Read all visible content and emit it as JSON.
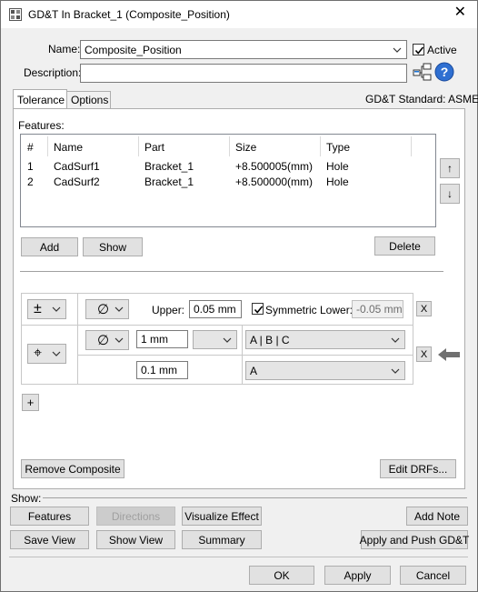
{
  "window": {
    "title": "GD&T In Bracket_1 (Composite_Position)",
    "close_glyph": "✕"
  },
  "header": {
    "name_label": "Name:",
    "name_value": "Composite_Position",
    "active_label": "Active",
    "active_checked": true,
    "description_label": "Description:",
    "description_value": ""
  },
  "tabs": [
    {
      "label": "Tolerance",
      "selected": true
    },
    {
      "label": "Options",
      "selected": false
    }
  ],
  "gdt_standard": "GD&T Standard: ASME",
  "features": {
    "label": "Features:",
    "columns": [
      "#",
      "Name",
      "Part",
      "Size",
      "Type"
    ],
    "rows": [
      [
        "1",
        "CadSurf1",
        "Bracket_1",
        "+8.500005(mm)",
        "Hole"
      ],
      [
        "2",
        "CadSurf2",
        "Bracket_1",
        "+8.500000(mm)",
        "Hole"
      ]
    ],
    "up_label": "↑",
    "down_label": "↓",
    "add_label": "Add",
    "show_label": "Show",
    "delete_label": "Delete"
  },
  "tolerance": {
    "profile_symbol": "±",
    "diameter_symbol": "∅",
    "position_symbol": "⌖",
    "upper_label": "Upper:",
    "upper_value": "0.05 mm",
    "symmetric_label": "Symmetric Lower:",
    "symmetric_checked": true,
    "lower_value": "-0.05 mm",
    "row1_value": "1 mm",
    "row1_modifier": "",
    "row1_datums": "A | B | C",
    "row2_value": "0.1 mm",
    "row2_datums": "A",
    "x_label": "X",
    "plus_label": "+"
  },
  "bottom": {
    "remove_composite_label": "Remove Composite",
    "edit_drfs_label": "Edit DRFs...",
    "show_label": "Show:",
    "features_label": "Features",
    "directions_label": "Directions",
    "visualize_label": "Visualize Effect",
    "add_note_label": "Add Note",
    "save_view_label": "Save View",
    "show_view_label": "Show View",
    "summary_label": "Summary",
    "apply_push_label": "Apply and Push GD&T",
    "ok_label": "OK",
    "apply_label": "Apply",
    "cancel_label": "Cancel"
  },
  "colors": {
    "accent_blue": "#1a73d6",
    "help_blue": "#2f6fd1"
  }
}
